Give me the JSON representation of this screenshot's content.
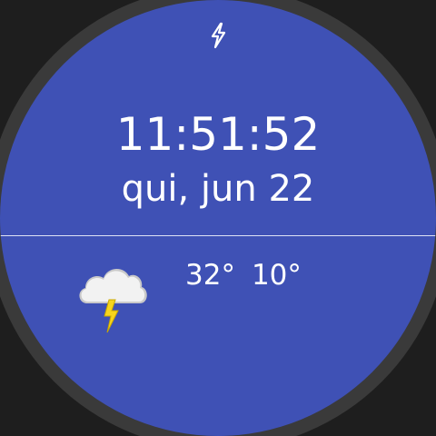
{
  "watch_face": {
    "time": "11:51:52",
    "date": "qui, jun 22",
    "status_icon": "charging-bolt-icon",
    "weather": {
      "condition_icon": "thunderstorm-cloud-icon",
      "high": "32°",
      "low": "10°"
    }
  },
  "colors": {
    "background": "#3f51b5",
    "bezel": "#3a3a3a",
    "text": "#ffffff",
    "cloud": "#f2f2f2",
    "bolt": "#f7d51d"
  }
}
